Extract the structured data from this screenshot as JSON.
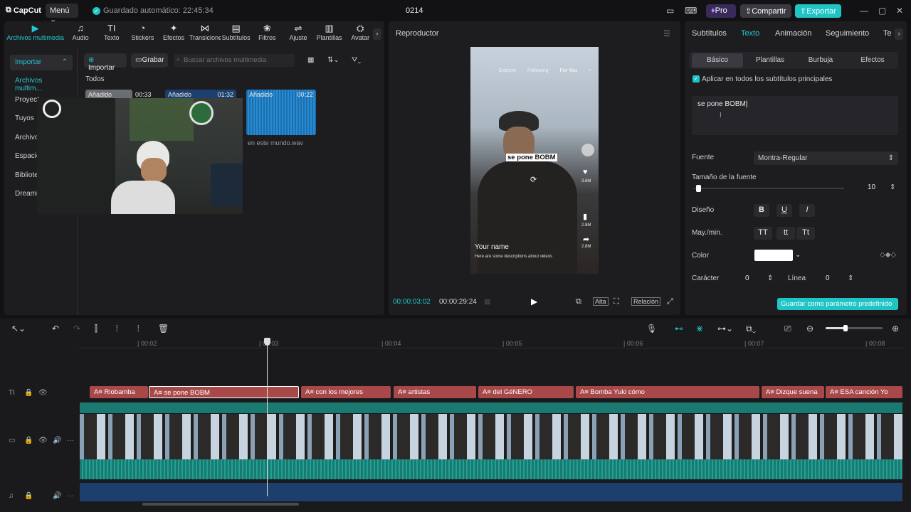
{
  "app": {
    "logo": "CapCut",
    "menu_label": "Menú",
    "autosave": "Guardado automático: 22:45:34",
    "project_title": "0214"
  },
  "header_buttons": {
    "pro": "Pro",
    "share": "Compartir",
    "export": "Exportar"
  },
  "toolbar": [
    {
      "label": "Archivos multimedia",
      "icon": "▶"
    },
    {
      "label": "Audio",
      "icon": "♫"
    },
    {
      "label": "Texto",
      "icon": "TI"
    },
    {
      "label": "Stickers",
      "icon": "◔"
    },
    {
      "label": "Efectos",
      "icon": "✦"
    },
    {
      "label": "Transiciones",
      "icon": "⋈"
    },
    {
      "label": "Subtítulos",
      "icon": "▤"
    },
    {
      "label": "Filtros",
      "icon": "❀"
    },
    {
      "label": "Ajuste",
      "icon": "⇌"
    },
    {
      "label": "Plantillas",
      "icon": "▥"
    },
    {
      "label": "Avatar",
      "icon": "⛭"
    }
  ],
  "sidebar": {
    "import": "Importar",
    "items": [
      "Archivos multim...",
      "Proyect",
      "Tuyos",
      "Archivo",
      "Espacio",
      "Bibliote",
      "Dreami"
    ]
  },
  "media": {
    "import_btn": "Importar",
    "record_btn": "Grabar",
    "search_placeholder": "Buscar archivos multimedia",
    "filter_all": "Todos",
    "items": [
      {
        "added": "Añadido",
        "duration": "00:33"
      },
      {
        "added": "Añadido",
        "duration": "01:32"
      },
      {
        "added": "Añadido",
        "duration": "00:22",
        "name": "en este mundo.wav"
      }
    ]
  },
  "player": {
    "title": "Reproductor",
    "current_time": "00:00:03:02",
    "total_time": "00:00:29:24",
    "ratio_btn": "Alta",
    "relation_btn": "Relación",
    "phone": {
      "tabs": [
        "Explore",
        "Following",
        "For You"
      ],
      "caption": "se pone BOBM",
      "username": "Your name",
      "desc": "Here are some descriptions about videos",
      "side_counts": [
        "3.6M",
        "2.8M",
        "2.8M"
      ]
    }
  },
  "props": {
    "tabs": [
      "Subtítulos",
      "Texto",
      "Animación",
      "Seguimiento",
      "Te"
    ],
    "subtabs": [
      "Básico",
      "Plantillas",
      "Burbuja",
      "Efectos"
    ],
    "apply_all": "Aplicar en todos los subtítulos principales",
    "text_value": "se pone BOBM",
    "font_label": "Fuente",
    "font_value": "Montra-Regular",
    "size_label": "Tamaño de la fuente",
    "size_value": "10",
    "size_fraction": 0.02,
    "design_label": "Diseño",
    "design_btns": [
      "B",
      "U",
      "I"
    ],
    "case_label": "May./min.",
    "case_btns": [
      "TT",
      "tt",
      "Tt"
    ],
    "color_label": "Color",
    "char_label": "Carácter",
    "char_value": "0",
    "line_label": "Línea",
    "line_value": "0",
    "save_preset": "Guardar como parámetro predefinido"
  },
  "timeline": {
    "ruler": [
      "00:02",
      "00:03",
      "00:04",
      "00:05",
      "00:06",
      "00:07",
      "00:08"
    ],
    "captions": [
      "Riobamba",
      "se pone BOBM",
      "con los mejores",
      "artistas",
      "del GéNERO",
      "Bomba Yuki cómo",
      "Dizque suena",
      "ESA canción Yo"
    ],
    "zoom_fraction": 0.35
  },
  "colors": {
    "accent": "#1fc5c5",
    "caption_clip": "#a84848",
    "audio_track": "#1a7a72",
    "bottom_track": "#1c3f6e"
  }
}
